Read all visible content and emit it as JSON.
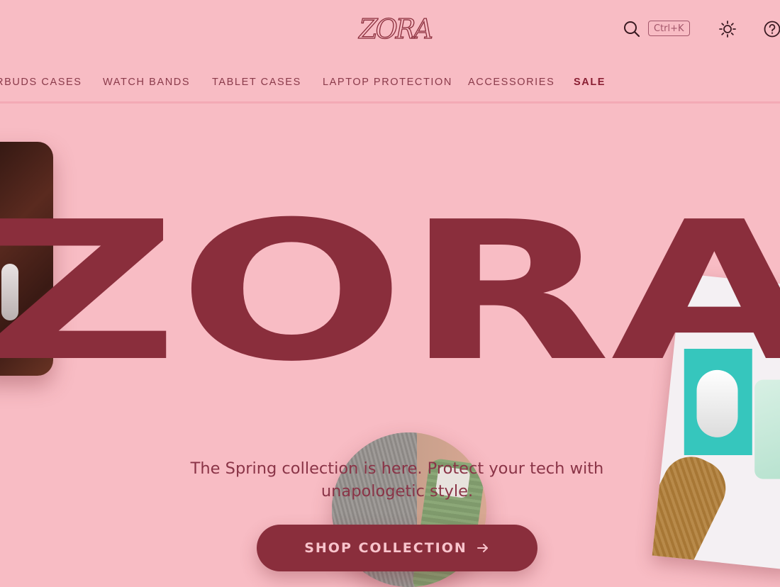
{
  "brand": {
    "logo_text": "ZORA",
    "hero_word": "ZORA"
  },
  "header": {
    "search_shortcut": "Ctrl+K",
    "icons": [
      "search-icon",
      "sun-icon",
      "help-icon"
    ]
  },
  "nav": {
    "items": [
      {
        "label": "RBUDS CASES"
      },
      {
        "label": "WATCH BANDS"
      },
      {
        "label": "TABLET CASES"
      },
      {
        "label": "LAPTOP PROTECTION"
      },
      {
        "label": "ACCESSORIES"
      },
      {
        "label": "SALE"
      }
    ]
  },
  "hero": {
    "tagline": "The Spring collection is here. Protect your tech with unapologetic style.",
    "cta_label": "SHOP COLLECTION"
  },
  "colors": {
    "background": "#f8bcc4",
    "accent": "#8a2e3c",
    "cta_text": "#f8c4cc",
    "sale": "#8a1f33"
  }
}
